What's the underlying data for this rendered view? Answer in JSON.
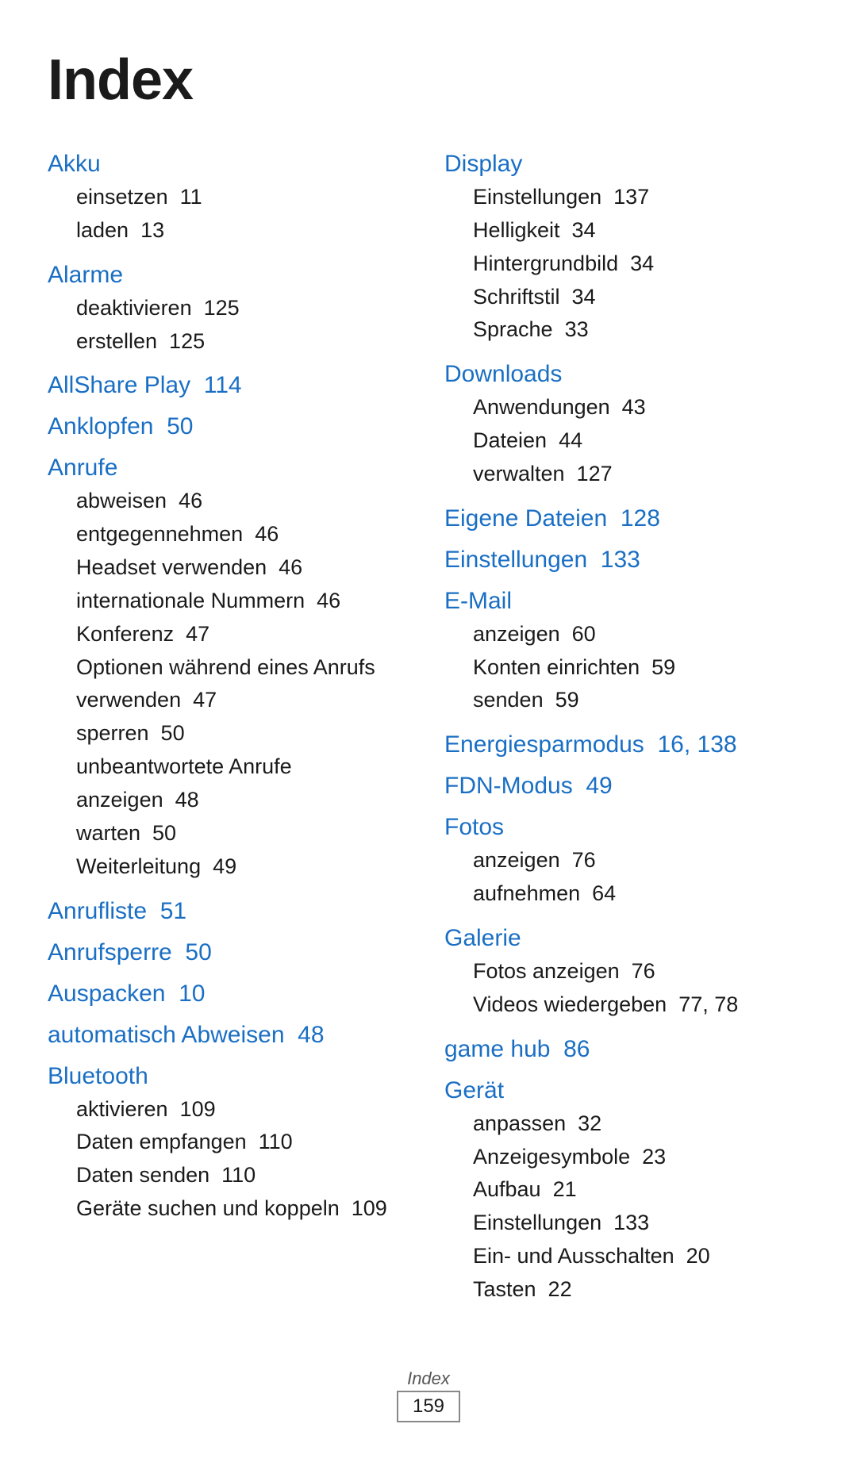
{
  "title": "Index",
  "left_column": [
    {
      "heading": "Akku",
      "heading_page": null,
      "subitems": [
        {
          "text": "einsetzen",
          "page": "11"
        },
        {
          "text": "laden",
          "page": "13"
        }
      ]
    },
    {
      "heading": "Alarme",
      "heading_page": null,
      "subitems": [
        {
          "text": "deaktivieren",
          "page": "125"
        },
        {
          "text": "erstellen",
          "page": "125"
        }
      ]
    },
    {
      "heading": "AllShare Play",
      "heading_page": "114",
      "subitems": []
    },
    {
      "heading": "Anklopfen",
      "heading_page": "50",
      "subitems": []
    },
    {
      "heading": "Anrufe",
      "heading_page": null,
      "subitems": [
        {
          "text": "abweisen",
          "page": "46"
        },
        {
          "text": "entgegennehmen",
          "page": "46"
        },
        {
          "text": "Headset verwenden",
          "page": "46"
        },
        {
          "text": "internationale\nNummern",
          "page": "46"
        },
        {
          "text": "Konferenz",
          "page": "47"
        },
        {
          "text": "Optionen während eines\nAnrufs verwenden",
          "page": "47"
        },
        {
          "text": "sperren",
          "page": "50"
        },
        {
          "text": "unbeantwortete Anrufe\nanzeigen",
          "page": "48"
        },
        {
          "text": "warten",
          "page": "50"
        },
        {
          "text": "Weiterleitung",
          "page": "49"
        }
      ]
    },
    {
      "heading": "Anrufliste",
      "heading_page": "51",
      "subitems": []
    },
    {
      "heading": "Anrufsperre",
      "heading_page": "50",
      "subitems": []
    },
    {
      "heading": "Auspacken",
      "heading_page": "10",
      "subitems": []
    },
    {
      "heading": "automatisch Abweisen",
      "heading_page": "48",
      "subitems": []
    },
    {
      "heading": "Bluetooth",
      "heading_page": null,
      "subitems": [
        {
          "text": "aktivieren",
          "page": "109"
        },
        {
          "text": "Daten empfangen",
          "page": "110"
        },
        {
          "text": "Daten senden",
          "page": "110"
        },
        {
          "text": "Geräte suchen und\nkoppeln",
          "page": "109"
        }
      ]
    }
  ],
  "right_column": [
    {
      "heading": "Display",
      "heading_page": null,
      "subitems": [
        {
          "text": "Einstellungen",
          "page": "137"
        },
        {
          "text": "Helligkeit",
          "page": "34"
        },
        {
          "text": "Hintergrundbild",
          "page": "34"
        },
        {
          "text": "Schriftstil",
          "page": "34"
        },
        {
          "text": "Sprache",
          "page": "33"
        }
      ]
    },
    {
      "heading": "Downloads",
      "heading_page": null,
      "subitems": [
        {
          "text": "Anwendungen",
          "page": "43"
        },
        {
          "text": "Dateien",
          "page": "44"
        },
        {
          "text": "verwalten",
          "page": "127"
        }
      ]
    },
    {
      "heading": "Eigene Dateien",
      "heading_page": "128",
      "subitems": []
    },
    {
      "heading": "Einstellungen",
      "heading_page": "133",
      "subitems": []
    },
    {
      "heading": "E-Mail",
      "heading_page": null,
      "subitems": [
        {
          "text": "anzeigen",
          "page": "60"
        },
        {
          "text": "Konten einrichten",
          "page": "59"
        },
        {
          "text": "senden",
          "page": "59"
        }
      ]
    },
    {
      "heading": "Energiesparmodus",
      "heading_page": "16, 138",
      "subitems": []
    },
    {
      "heading": "FDN-Modus",
      "heading_page": "49",
      "subitems": []
    },
    {
      "heading": "Fotos",
      "heading_page": null,
      "subitems": [
        {
          "text": "anzeigen",
          "page": "76"
        },
        {
          "text": "aufnehmen",
          "page": "64"
        }
      ]
    },
    {
      "heading": "Galerie",
      "heading_page": null,
      "subitems": [
        {
          "text": "Fotos anzeigen",
          "page": "76"
        },
        {
          "text": "Videos wiedergeben",
          "page": "77, 78"
        }
      ]
    },
    {
      "heading": "game hub",
      "heading_page": "86",
      "subitems": []
    },
    {
      "heading": "Gerät",
      "heading_page": null,
      "subitems": [
        {
          "text": "anpassen",
          "page": "32"
        },
        {
          "text": "Anzeigesymbole",
          "page": "23"
        },
        {
          "text": "Aufbau",
          "page": "21"
        },
        {
          "text": "Einstellungen",
          "page": "133"
        },
        {
          "text": "Ein- und Ausschalten",
          "page": "20"
        },
        {
          "text": "Tasten",
          "page": "22"
        }
      ]
    }
  ],
  "footer": {
    "label": "Index",
    "page": "159"
  }
}
